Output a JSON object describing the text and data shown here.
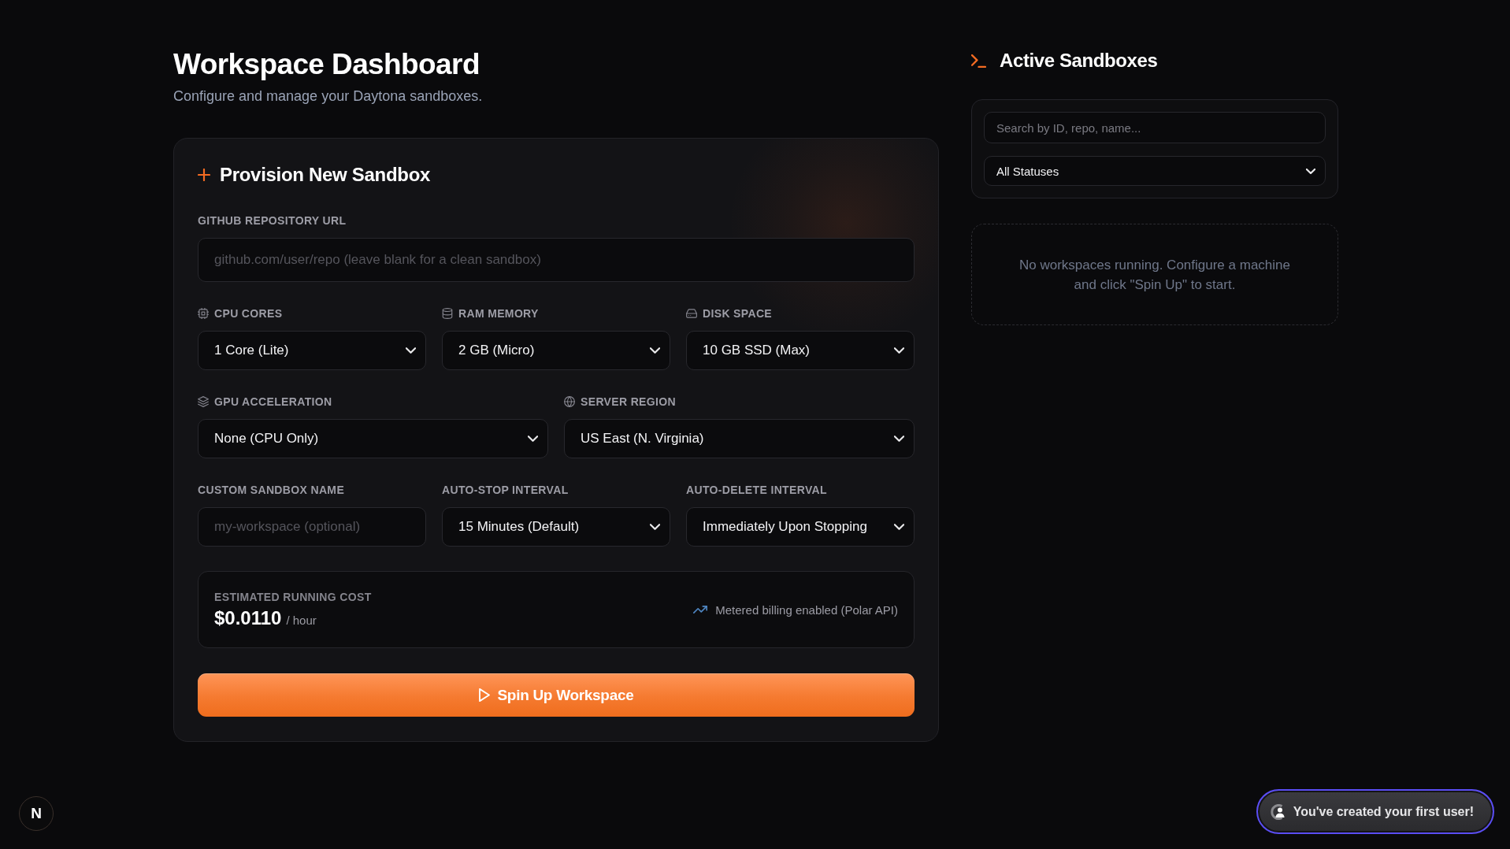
{
  "header": {
    "title": "Workspace Dashboard",
    "subtitle": "Configure and manage your Daytona sandboxes."
  },
  "provision_form": {
    "title": "Provision New Sandbox",
    "rows": [
      [
        {
          "kind": "text",
          "label": "GITHUB REPOSITORY URL",
          "placeholder": "github.com/user/repo (leave blank for a clean sandbox)"
        }
      ],
      [
        {
          "kind": "select",
          "label": "CPU CORES",
          "value": "1 Core (Lite)"
        },
        {
          "kind": "select",
          "label": "RAM MEMORY",
          "value": "2 GB (Micro)"
        },
        {
          "kind": "select",
          "label": "DISK SPACE",
          "value": "10 GB SSD (Max)"
        }
      ],
      [
        {
          "kind": "select",
          "label": "GPU ACCELERATION",
          "value": "None (CPU Only)"
        },
        {
          "kind": "select",
          "label": "SERVER REGION",
          "value": "US East (N. Virginia)"
        }
      ],
      [
        {
          "kind": "text",
          "label": "CUSTOM SANDBOX NAME",
          "placeholder": "my-workspace (optional)"
        },
        {
          "kind": "select",
          "label": "AUTO-STOP INTERVAL",
          "value": "15 Minutes (Default)"
        },
        {
          "kind": "select",
          "label": "AUTO-DELETE INTERVAL",
          "value": "Immediately Upon Stopping"
        }
      ]
    ],
    "cost": {
      "label": "ESTIMATED RUNNING COST",
      "amount": "$0.0110",
      "unit": "/ hour",
      "note": "Metered billing enabled (Polar API)"
    },
    "submit_button": "Spin Up Workspace"
  },
  "active_sandboxes": {
    "title": "Active Sandboxes",
    "search": {
      "placeholder": "Search by ID, repo, name..."
    },
    "status_filter": {
      "value": "All Statuses"
    },
    "empty_message": "No workspaces running. Configure a machine and click \"Spin Up\" to start."
  },
  "dev_indicator": {
    "label": "N"
  },
  "toast": {
    "message": "You've created your first user!"
  }
}
